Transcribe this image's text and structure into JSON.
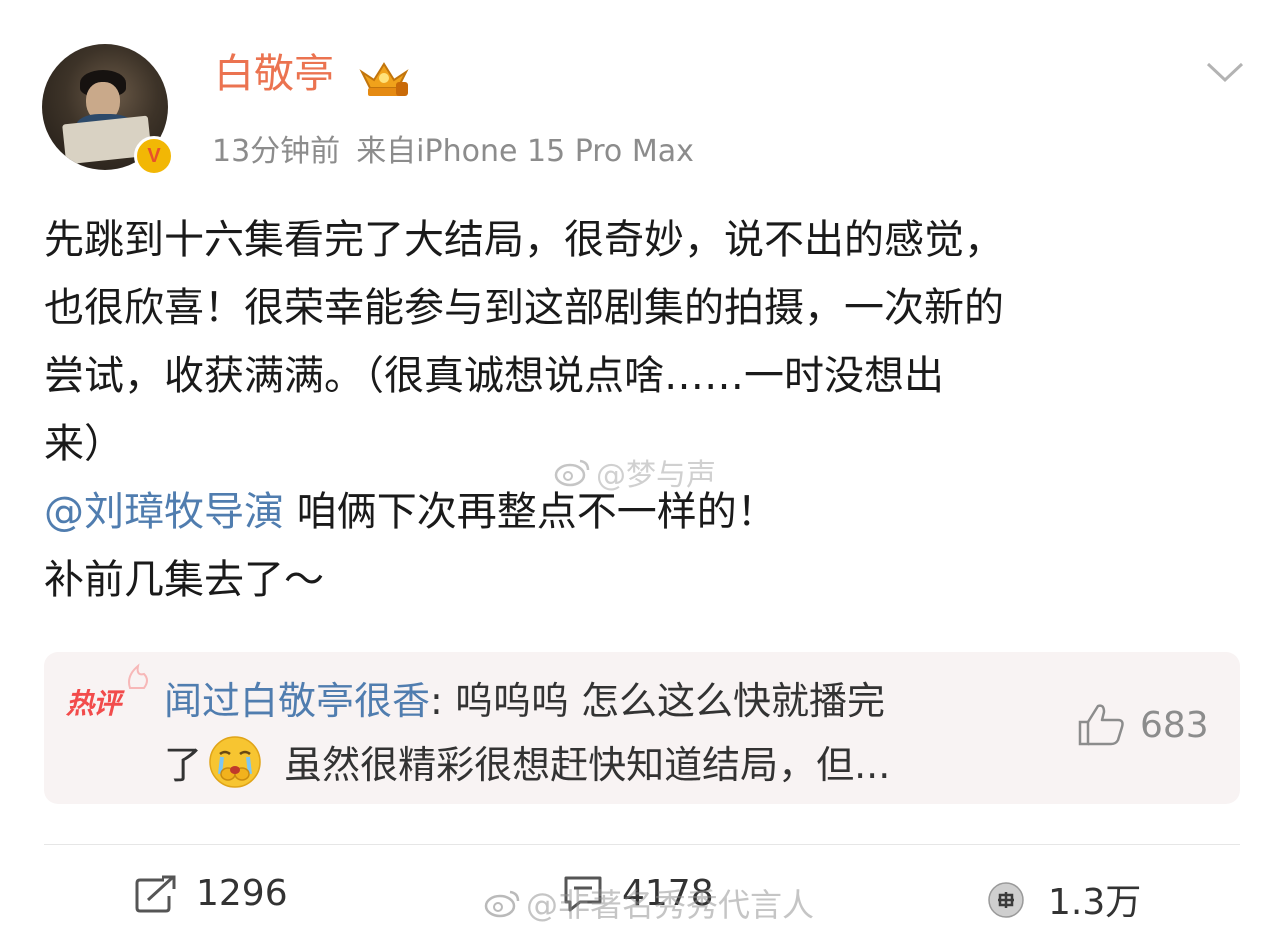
{
  "post": {
    "username": "白敬亭",
    "time": "13分钟前",
    "source": "来自iPhone 15 Pro Max",
    "content_lines": [
      "先跳到十六集看完了大结局，很奇妙，说不出的感觉，",
      "也很欣喜！很荣幸能参与到这部剧集的拍摄，一次新的",
      "尝试，收获满满。（很真诚想说点啥……一时没想出",
      "来）"
    ],
    "mention": "@刘璋牧导演",
    "mention_tail": " 咱俩下次再整点不一样的！",
    "last_line": "补前几集去了～"
  },
  "watermarks": {
    "top": "@梦与声",
    "bottom": "@非著名秀秀代言人"
  },
  "hot_comment": {
    "tag": "热评",
    "user": "闻过白敬亭很香",
    "text_a": ": 呜呜呜 怎么这么快就播完",
    "text_b": "了",
    "text_c": " 虽然很精彩很想赶快知道结局，但...",
    "likes": "683"
  },
  "toolbar": {
    "reposts": "1296",
    "comments": "4178",
    "likes": "1.3万"
  },
  "colors": {
    "username": "#eb7350",
    "link": "#507daf",
    "meta": "#8c8c8c",
    "hot_tag": "#f24b4b",
    "hot_bg": "#f8f3f3"
  },
  "icons": [
    "crown-icon",
    "verified-badge-icon",
    "chevron-down-icon",
    "weibo-logo-icon",
    "crying-emoji-icon",
    "thumbs-up-icon",
    "repost-icon",
    "comment-icon",
    "like-icon"
  ]
}
